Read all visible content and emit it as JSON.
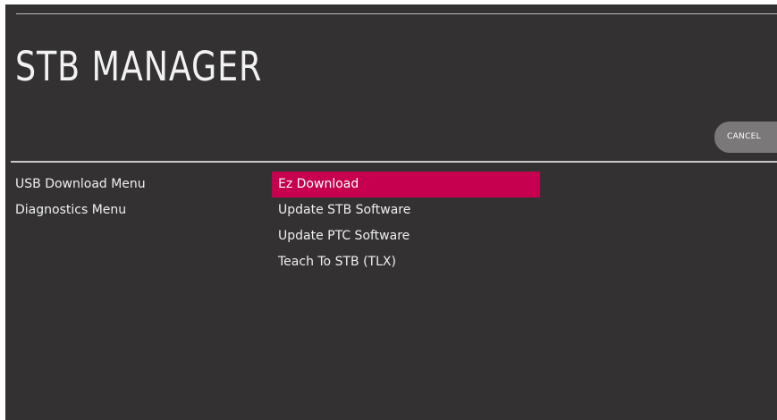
{
  "screen": {
    "title": "STB MANAGER",
    "cancel_label": "CANCEL",
    "background_color": "#333132",
    "accent_color": "#c6004e"
  },
  "left_menu": {
    "items": [
      {
        "label": "USB Download Menu"
      },
      {
        "label": "Diagnostics Menu"
      }
    ]
  },
  "right_menu": {
    "selected_index": 0,
    "items": [
      {
        "label": "Ez Download"
      },
      {
        "label": "Update STB Software"
      },
      {
        "label": "Update PTC Software"
      },
      {
        "label": "Teach To STB (TLX)"
      }
    ]
  }
}
